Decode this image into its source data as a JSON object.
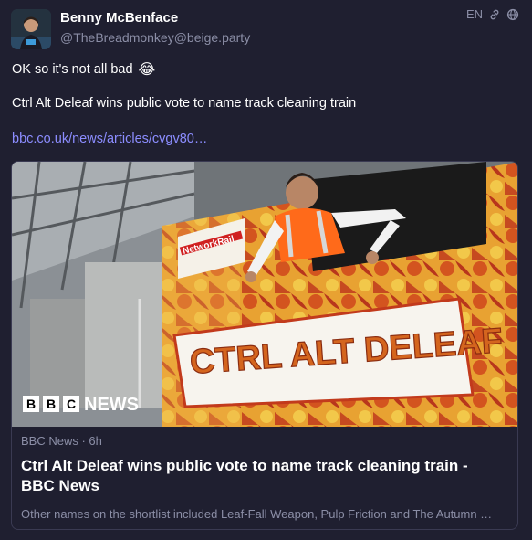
{
  "author": {
    "name": "Benny McBenface",
    "handle": "@TheBreadmonkey@beige.party"
  },
  "meta": {
    "language": "EN",
    "icons": [
      "link-icon",
      "globe-icon"
    ]
  },
  "post": {
    "line1": "OK so it's not all bad",
    "line1_emoji": "😂",
    "line2": "Ctrl Alt Deleaf wins public vote to name track cleaning train",
    "link": "bbc.co.uk/news/articles/cvgv80…"
  },
  "card": {
    "image_texts": {
      "sign": "CTRL ALT DELEAF",
      "logo": "NetworkRail",
      "bbc_letters": [
        "B",
        "B",
        "C"
      ],
      "bbc_news": "NEWS"
    },
    "source": "BBC News · 6h",
    "title": "Ctrl Alt Deleaf wins public vote to name track cleaning train - BBC News",
    "description": "Other names on the shortlist included Leaf-Fall Weapon, Pulp Friction and The Autumn …"
  },
  "colors": {
    "background": "#1f1f30",
    "link": "#8c8dff",
    "muted": "#8b8ea6",
    "border": "#3a3a52"
  }
}
